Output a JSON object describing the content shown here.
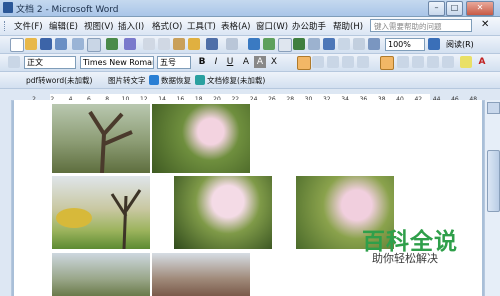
{
  "window": {
    "title": "文档 2 - Microsoft Word",
    "min": "–",
    "max": "□",
    "close": "✕"
  },
  "menu": {
    "items": [
      "文件(F)",
      "编辑(E)",
      "视图(V)",
      "插入(I)",
      "格式(O)",
      "工具(T)",
      "表格(A)",
      "窗口(W)",
      "办公助手",
      "帮助(H)"
    ],
    "help_placeholder": "键入需要帮助的问题",
    "close_doc": "✕"
  },
  "standard_toolbar": {
    "zoom": "100%",
    "read_label": "阅读(R)"
  },
  "formatting_toolbar": {
    "style": "正文",
    "font": "Times New Roman",
    "size": "五号"
  },
  "plugin_toolbar": {
    "pdf_word": "pdf转word(未加载)",
    "pic_text": "图片转文字",
    "data_recover": "数据恢复",
    "file_repair": "文档修复(未加载)"
  },
  "ruler": {
    "marks": [
      "2",
      "2",
      "4",
      "6",
      "8",
      "10",
      "12",
      "14",
      "16",
      "18",
      "20",
      "22",
      "24",
      "26",
      "28",
      "30",
      "32",
      "34",
      "36",
      "38",
      "40",
      "42",
      "44",
      "46",
      "48"
    ]
  },
  "watermark": {
    "title": "百科全说",
    "subtitle": "助你轻松解决"
  },
  "colors": {
    "title_bar": "#b5cde9",
    "toolbar": "#dbe6f4",
    "watermark_green": "#2f9f4a"
  }
}
